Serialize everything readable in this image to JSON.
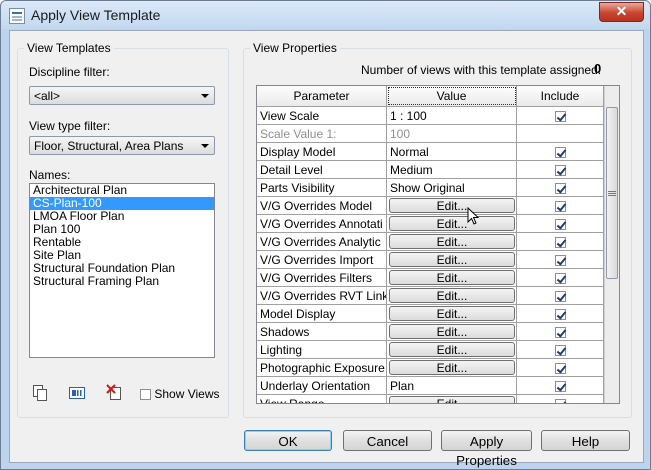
{
  "window": {
    "title": "Apply View Template",
    "close_glyph": "✕"
  },
  "view_templates": {
    "group_title": "View Templates",
    "discipline_label": "Discipline filter:",
    "discipline_value": "<all>",
    "view_type_label": "View type filter:",
    "view_type_value": "Floor, Structural, Area Plans",
    "names_label": "Names:",
    "names": [
      "Architectural Plan",
      "CS-Plan-100",
      "LMOA Floor Plan",
      "Plan 100",
      "Rentable",
      "Site Plan",
      "Structural Foundation Plan",
      "Structural Framing Plan"
    ],
    "selected_index": 1,
    "show_views_label": "Show Views",
    "show_views_checked": false,
    "toolbar_icons": [
      "duplicate-icon",
      "rename-icon",
      "delete-icon"
    ]
  },
  "view_properties": {
    "group_title": "View Properties",
    "count_label": "Number of views with this template assigned:",
    "count_value": "0",
    "columns": [
      "Parameter",
      "Value",
      "Include"
    ],
    "rows": [
      {
        "param": "View Scale",
        "value": "1 : 100",
        "include": true,
        "button": false,
        "disabled": false
      },
      {
        "param": "Scale Value    1:",
        "value": "100",
        "include": null,
        "button": false,
        "disabled": true
      },
      {
        "param": "Display Model",
        "value": "Normal",
        "include": true,
        "button": false,
        "disabled": false
      },
      {
        "param": "Detail Level",
        "value": "Medium",
        "include": true,
        "button": false,
        "disabled": false
      },
      {
        "param": "Parts Visibility",
        "value": "Show Original",
        "include": true,
        "button": false,
        "disabled": false
      },
      {
        "param": "V/G Overrides Model",
        "value": "Edit...",
        "include": true,
        "button": true,
        "disabled": false
      },
      {
        "param": "V/G Overrides Annotati",
        "value": "Edit...",
        "include": true,
        "button": true,
        "disabled": false
      },
      {
        "param": "V/G Overrides Analytic",
        "value": "Edit...",
        "include": true,
        "button": true,
        "disabled": false
      },
      {
        "param": "V/G Overrides Import",
        "value": "Edit...",
        "include": true,
        "button": true,
        "disabled": false
      },
      {
        "param": "V/G Overrides Filters",
        "value": "Edit...",
        "include": true,
        "button": true,
        "disabled": false
      },
      {
        "param": "V/G Overrides RVT Link",
        "value": "Edit...",
        "include": true,
        "button": true,
        "disabled": false
      },
      {
        "param": "Model Display",
        "value": "Edit...",
        "include": true,
        "button": true,
        "disabled": false
      },
      {
        "param": "Shadows",
        "value": "Edit...",
        "include": true,
        "button": true,
        "disabled": false
      },
      {
        "param": "Lighting",
        "value": "Edit...",
        "include": true,
        "button": true,
        "disabled": false
      },
      {
        "param": "Photographic Exposure",
        "value": "Edit...",
        "include": true,
        "button": true,
        "disabled": false
      },
      {
        "param": "Underlay Orientation",
        "value": "Plan",
        "include": true,
        "button": false,
        "disabled": false
      },
      {
        "param": "View Range",
        "value": "Edit...",
        "include": true,
        "button": true,
        "disabled": false
      }
    ]
  },
  "buttons": {
    "ok": "OK",
    "cancel": "Cancel",
    "apply": "Apply Properties",
    "help": "Help"
  }
}
